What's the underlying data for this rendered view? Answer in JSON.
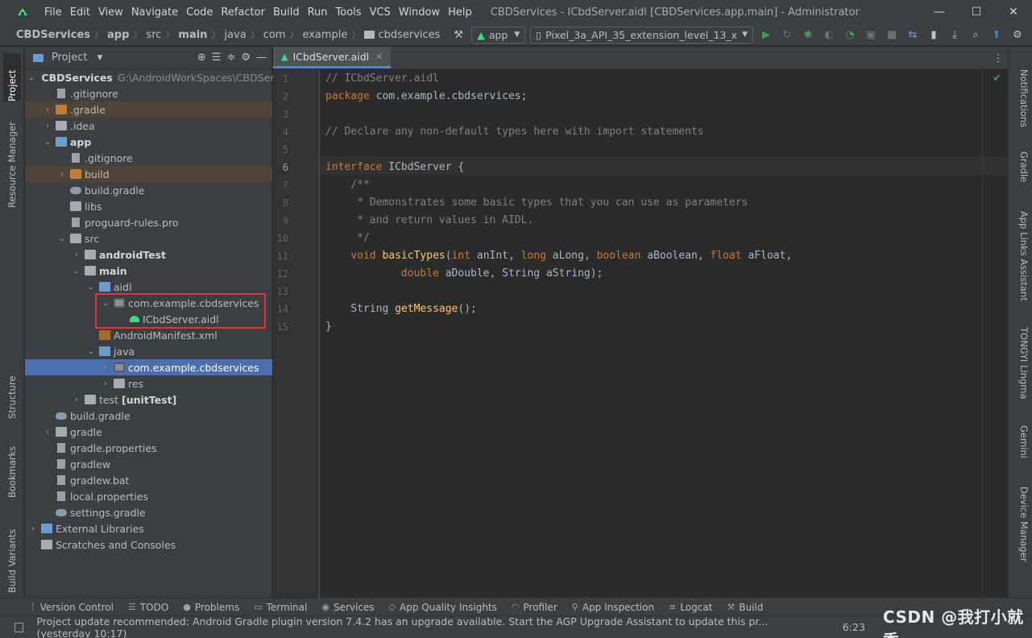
{
  "titlebar": {
    "menu": [
      "File",
      "Edit",
      "View",
      "Navigate",
      "Code",
      "Refactor",
      "Build",
      "Run",
      "Tools",
      "VCS",
      "Window",
      "Help"
    ],
    "window_title": "CBDServices - ICbdServer.aidl [CBDServices.app.main] - Administrator",
    "minimize": "—",
    "maximize": "☐",
    "close": "✕"
  },
  "navbar": {
    "crumbs": [
      "CBDServices",
      "app",
      "src",
      "main",
      "java",
      "com",
      "example",
      "cbdservices"
    ],
    "run_config": "app",
    "device": "Pixel_3a_API_35_extension_level_13_x"
  },
  "left_strip": [
    "Project",
    "Resource Manager",
    "Structure",
    "Bookmarks",
    "Build Variants"
  ],
  "right_strip": [
    "Notifications",
    "Gradle",
    "App Links Assistant",
    "TONGYI Lingma",
    "Gemini",
    "Device Manager"
  ],
  "project": {
    "title": "Project",
    "tree": [
      {
        "label": "CBDServices",
        "extra": "G:\\AndroidWorkSpaces\\CBDSer",
        "bold": true
      },
      {
        "label": ".gitignore"
      },
      {
        "label": ".gradle"
      },
      {
        "label": ".idea"
      },
      {
        "label": "app",
        "bold": true
      },
      {
        "label": ".gitignore"
      },
      {
        "label": "build"
      },
      {
        "label": "build.gradle"
      },
      {
        "label": "libs"
      },
      {
        "label": "proguard-rules.pro"
      },
      {
        "label": "src"
      },
      {
        "label": "androidTest",
        "bold": true
      },
      {
        "label": "main",
        "bold": true
      },
      {
        "label": "aidl"
      },
      {
        "label": "com.example.cbdservices"
      },
      {
        "label": "ICbdServer.aidl"
      },
      {
        "label": "AndroidManifest.xml"
      },
      {
        "label": "java"
      },
      {
        "label": "com.example.cbdservices"
      },
      {
        "label": "res"
      },
      {
        "label": "test",
        "extra": "[unitTest]"
      },
      {
        "label": "build.gradle"
      },
      {
        "label": "gradle"
      },
      {
        "label": "gradle.properties"
      },
      {
        "label": "gradlew"
      },
      {
        "label": "gradlew.bat"
      },
      {
        "label": "local.properties"
      },
      {
        "label": "settings.gradle"
      },
      {
        "label": "External Libraries"
      },
      {
        "label": "Scratches and Consoles"
      }
    ]
  },
  "editor": {
    "tab": "ICbdServer.aidl",
    "line_numbers": [
      "1",
      "2",
      "3",
      "4",
      "5",
      "6",
      "7",
      "8",
      "9",
      "10",
      "11",
      "12",
      "13",
      "14",
      "15"
    ],
    "code": {
      "l1": "// ICbdServer.aidl",
      "l2_kw": "package",
      "l2": " com.example.cbdservices;",
      "l4": "// Declare any non-default types here with import statements",
      "l6_kw": "interface",
      "l6": " ICbdServer {",
      "l7": "    /**",
      "l8": "     * Demonstrates some basic types that you can use as parameters",
      "l9": "     * and return values in AIDL.",
      "l10": "     */",
      "l11_kw1": "void",
      "l11_fn": "basicTypes",
      "l11_kw2": "int",
      "l11_a": " anInt, ",
      "l11_kw3": "long",
      "l11_b": " aLong, ",
      "l11_kw4": "boolean",
      "l11_c": " aBoolean, ",
      "l11_kw5": "float",
      "l11_d": " aFloat,",
      "l12_kw": "double",
      "l12": " aDouble, String aString);",
      "l14_ty": "String",
      "l14_fn": "getMessage",
      "l14": "();",
      "l15": "}"
    }
  },
  "toolwindows": [
    {
      "icon": "branch-icon",
      "label": "Version Control"
    },
    {
      "icon": "list-icon",
      "label": "TODO"
    },
    {
      "icon": "warning-icon",
      "label": "Problems"
    },
    {
      "icon": "terminal-icon",
      "label": "Terminal"
    },
    {
      "icon": "services-icon",
      "label": "Services"
    },
    {
      "icon": "quality-icon",
      "label": "App Quality Insights"
    },
    {
      "icon": "profiler-icon",
      "label": "Profiler"
    },
    {
      "icon": "inspect-icon",
      "label": "App Inspection"
    },
    {
      "icon": "logcat-icon",
      "label": "Logcat"
    },
    {
      "icon": "hammer-icon",
      "label": "Build"
    }
  ],
  "statusbar": {
    "message": "Project update recommended: Android Gradle plugin version 7.4.2 has an upgrade available. Start the AGP Upgrade Assistant to update this pr... (yesterday 10:17)",
    "position": "6:23",
    "watermark": "CSDN @我打小就秀"
  },
  "colors": {
    "selection": "#4b6eaf",
    "highlight_box": "#e53333",
    "keyword": "#cc7832",
    "function": "#ffc66d",
    "comment": "#808080"
  }
}
